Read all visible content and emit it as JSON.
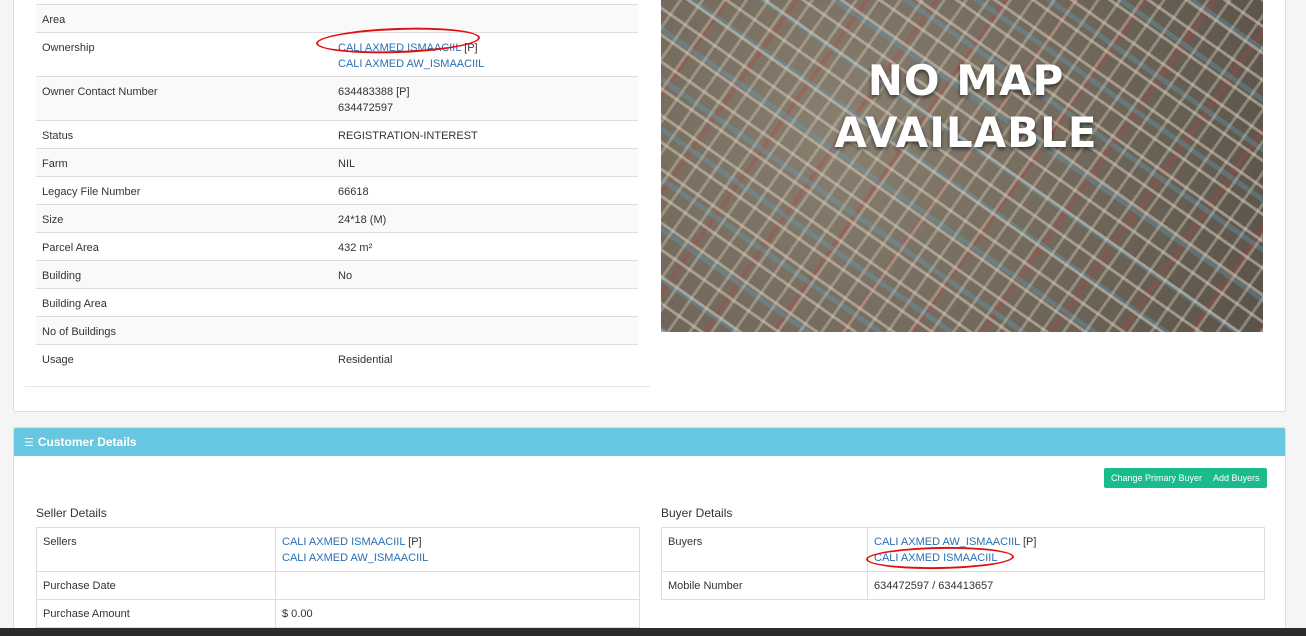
{
  "property": {
    "rows": [
      {
        "label": "Area",
        "lines": []
      },
      {
        "label": "Ownership",
        "lines": [
          {
            "text": "CALI AXMED ISMAACIIL",
            "suffix": " [P]",
            "link": true
          },
          {
            "text": "CALI AXMED AW_ISMAACIIL",
            "suffix": "",
            "link": true
          }
        ]
      },
      {
        "label": "Owner Contact Number",
        "lines": [
          {
            "text": "634483388 [P]",
            "suffix": "",
            "link": false
          },
          {
            "text": "634472597",
            "suffix": "",
            "link": false
          }
        ]
      },
      {
        "label": "Status",
        "lines": [
          {
            "text": "REGISTRATION-INTEREST",
            "suffix": "",
            "link": false
          }
        ]
      },
      {
        "label": "Farm",
        "lines": [
          {
            "text": "NIL",
            "suffix": "",
            "link": false
          }
        ]
      },
      {
        "label": "Legacy File Number",
        "lines": [
          {
            "text": "66618",
            "suffix": "",
            "link": false
          }
        ]
      },
      {
        "label": "Size",
        "lines": [
          {
            "text": "24*18 (M)",
            "suffix": "",
            "link": false
          }
        ]
      },
      {
        "label": "Parcel Area",
        "lines": [
          {
            "text": "432 m²",
            "suffix": "",
            "link": false
          }
        ]
      },
      {
        "label": "Building",
        "lines": [
          {
            "text": "No",
            "suffix": "",
            "link": false
          }
        ]
      },
      {
        "label": "Building Area",
        "lines": []
      },
      {
        "label": "No of Buildings",
        "lines": []
      },
      {
        "label": "Usage",
        "lines": [
          {
            "text": "Residential",
            "suffix": "",
            "link": false
          }
        ]
      }
    ]
  },
  "map": {
    "line1": "NO MAP",
    "line2": "AVAILABLE"
  },
  "customer": {
    "title": "Customer Details",
    "change_primary_buyer": "Change Primary Buyer",
    "add_buyers": "Add Buyers",
    "seller_title": "Seller Details",
    "buyer_title": "Buyer Details",
    "sellers_label": "Sellers",
    "sellers": [
      {
        "text": "CALI AXMED ISMAACIIL",
        "suffix": " [P]"
      },
      {
        "text": "CALI AXMED AW_ISMAACIIL",
        "suffix": ""
      }
    ],
    "purchase_date_label": "Purchase Date",
    "purchase_date": "",
    "purchase_amount_label": "Purchase Amount",
    "purchase_amount": "$ 0.00",
    "buyers_label": "Buyers",
    "buyers": [
      {
        "text": "CALI AXMED AW_ISMAACIIL",
        "suffix": " [P]"
      },
      {
        "text": "CALI AXMED ISMAACIIL",
        "suffix": ""
      }
    ],
    "mobile_label": "Mobile Number",
    "mobile": "634472597 / 634413657"
  },
  "colors": {
    "header": "#67c6e0",
    "button": "#1bbc8c",
    "link": "#2a6fb3",
    "annotation": "#e01010"
  }
}
